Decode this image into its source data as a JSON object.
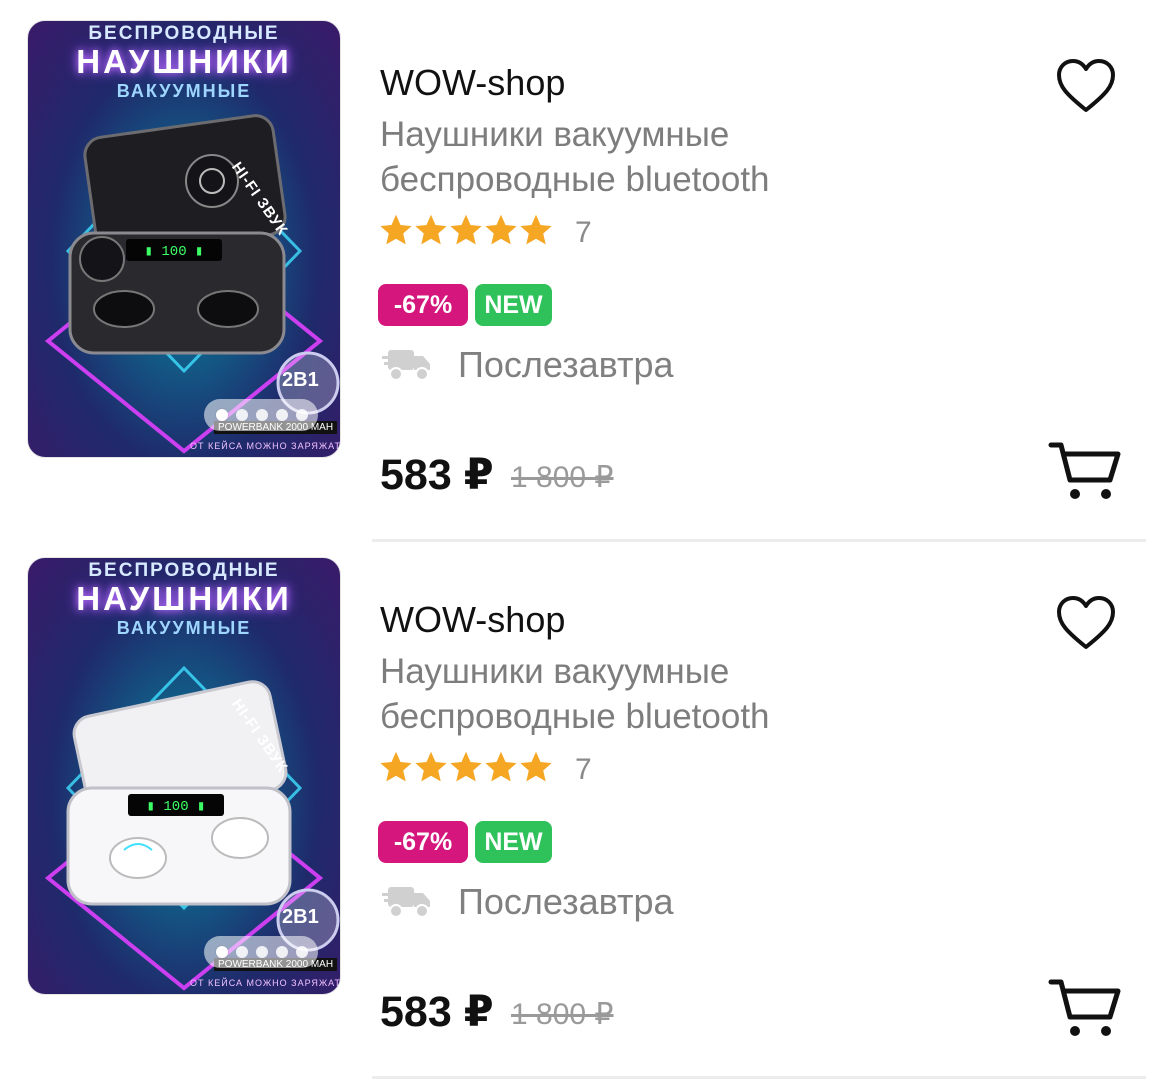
{
  "colors": {
    "sale_badge": "#d4167d",
    "new_badge": "#2fc25b",
    "star": "#f5a623",
    "text_primary": "#111111",
    "text_secondary": "#7d7d7d"
  },
  "icons": {
    "favorite": "heart-outline-icon",
    "cart": "shopping-cart-icon",
    "delivery": "truck-icon",
    "rating": "star-icon"
  },
  "products": [
    {
      "image": {
        "line1": "беспроводные",
        "line2": "наушники",
        "line3": "вакуумные",
        "side": "Hi-Fi звук",
        "badge": "2в1",
        "foot1": "POWERBANK 2000 MAH",
        "foot2": "ОТ КЕЙСА МОЖНО ЗАРЯЖАТЬ",
        "case_color": "black",
        "dots_count": 5,
        "active_dot": 0
      },
      "shop": "WOW-shop",
      "title_line1": "Наушники вакуумные",
      "title_line2": "беспроводные bluetooth",
      "rating_stars": 5,
      "rating_count": "7",
      "discount": "-67%",
      "new_label": "NEW",
      "delivery": "Послезавтра",
      "price": "583 ₽",
      "old_price": "1 800 ₽"
    },
    {
      "image": {
        "line1": "беспроводные",
        "line2": "наушники",
        "line3": "вакуумные",
        "side": "Hi-Fi звук",
        "badge": "2в1",
        "foot1": "POWERBANK 2000 MAH",
        "foot2": "ОТ КЕЙСА МОЖНО ЗАРЯЖАТЬ",
        "case_color": "white",
        "dots_count": 5,
        "active_dot": 0
      },
      "shop": "WOW-shop",
      "title_line1": "Наушники вакуумные",
      "title_line2": "беспроводные bluetooth",
      "rating_stars": 5,
      "rating_count": "7",
      "discount": "-67%",
      "new_label": "NEW",
      "delivery": "Послезавтра",
      "price": "583 ₽",
      "old_price": "1 800 ₽"
    }
  ]
}
